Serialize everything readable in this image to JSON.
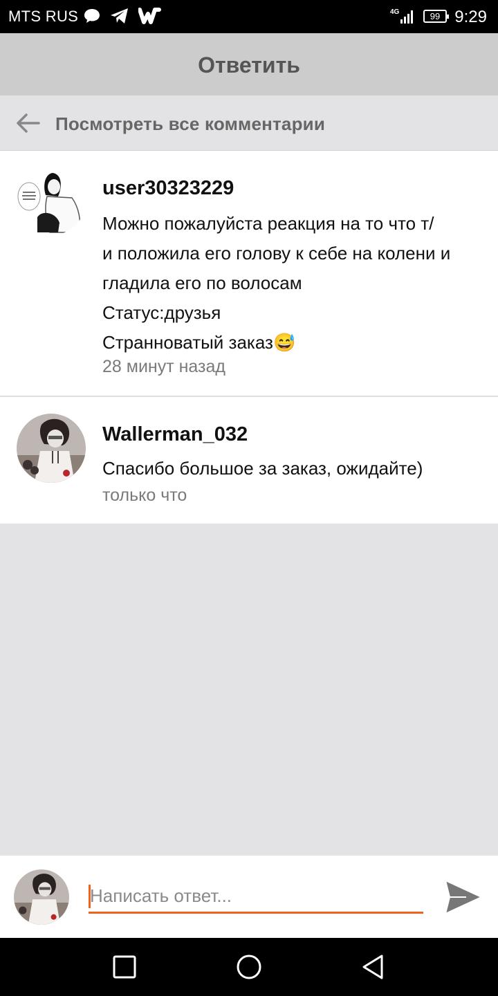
{
  "status_bar": {
    "carrier": "MTS RUS",
    "network": "4G",
    "battery": "99",
    "time": "9:29",
    "icons": [
      "chat-bubble-icon",
      "telegram-icon",
      "wattpad-icon",
      "signal-icon"
    ]
  },
  "header": {
    "title": "Ответить"
  },
  "view_all": {
    "label": "Посмотреть все комментарии",
    "icon": "arrow-left-icon"
  },
  "comments": [
    {
      "username": "user30323229",
      "lines": [
        "Можно пожалуйста реакция на то что т/",
        "и положила его голову к себе на колени и",
        "гладила его по волосам",
        "Статус:друзья",
        "Странноватый заказ😅"
      ],
      "time": "28 минут назад"
    },
    {
      "username": "Wallerman_032",
      "lines": [
        "Спасибо большое за заказ, ожидайте)"
      ],
      "time": "только что"
    }
  ],
  "reply": {
    "placeholder": "Написать ответ...",
    "value": "",
    "send_icon": "send-icon"
  },
  "colors": {
    "accent": "#f2621f",
    "header_bg": "#cccccc",
    "page_bg": "#e3e2e5"
  },
  "nav": {
    "icons": [
      "square-recent-icon",
      "circle-home-icon",
      "triangle-back-icon"
    ]
  }
}
